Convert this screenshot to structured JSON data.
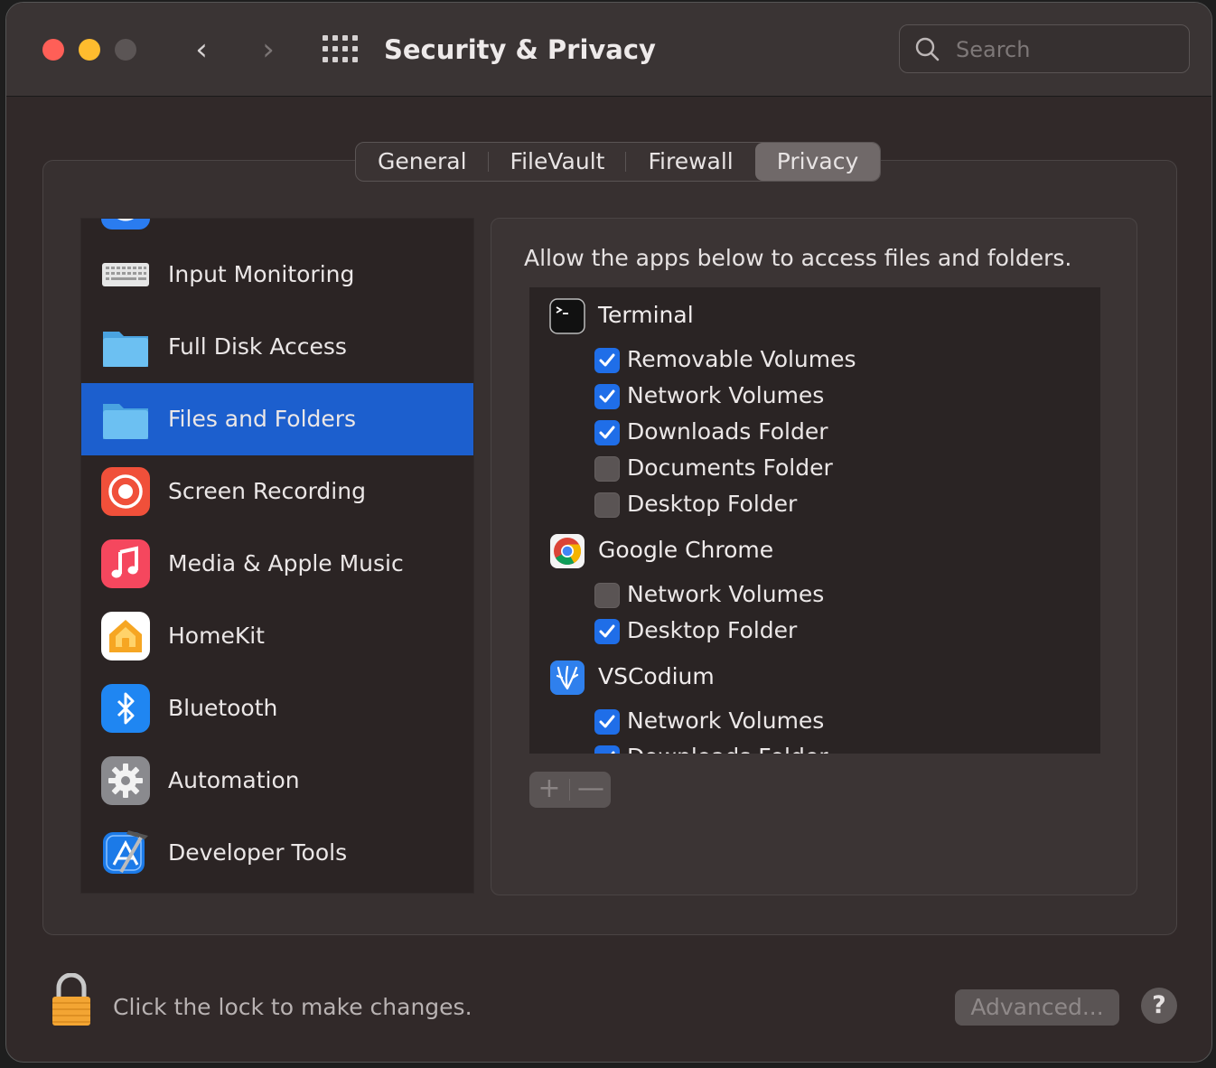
{
  "window": {
    "title": "Security & Privacy",
    "search_placeholder": "Search",
    "back_glyph": "‹",
    "forward_glyph": "›"
  },
  "tabs": [
    {
      "label": "General",
      "active": false
    },
    {
      "label": "FileVault",
      "active": false
    },
    {
      "label": "Firewall",
      "active": false
    },
    {
      "label": "Privacy",
      "active": true
    }
  ],
  "privacy_list": [
    {
      "label": "Input Monitoring",
      "icon": "keyboard-icon",
      "selected": false
    },
    {
      "label": "Full Disk Access",
      "icon": "folder-icon",
      "selected": false
    },
    {
      "label": "Files and Folders",
      "icon": "folder-icon",
      "selected": true
    },
    {
      "label": "Screen Recording",
      "icon": "screen-record-icon",
      "selected": false
    },
    {
      "label": "Media & Apple Music",
      "icon": "music-note-icon",
      "selected": false
    },
    {
      "label": "HomeKit",
      "icon": "home-icon",
      "selected": false
    },
    {
      "label": "Bluetooth",
      "icon": "bluetooth-icon",
      "selected": false
    },
    {
      "label": "Automation",
      "icon": "gear-icon",
      "selected": false
    },
    {
      "label": "Developer Tools",
      "icon": "developer-tools-icon",
      "selected": false
    }
  ],
  "detail": {
    "description": "Allow the apps below to access files and folders.",
    "apps": [
      {
        "name": "Terminal",
        "icon": "terminal-icon",
        "permissions": [
          {
            "label": "Removable Volumes",
            "checked": true
          },
          {
            "label": "Network Volumes",
            "checked": true
          },
          {
            "label": "Downloads Folder",
            "checked": true
          },
          {
            "label": "Documents Folder",
            "checked": false
          },
          {
            "label": "Desktop Folder",
            "checked": false
          }
        ]
      },
      {
        "name": "Google Chrome",
        "icon": "chrome-icon",
        "permissions": [
          {
            "label": "Network Volumes",
            "checked": false
          },
          {
            "label": "Desktop Folder",
            "checked": true
          }
        ]
      },
      {
        "name": "VSCodium",
        "icon": "vscodium-icon",
        "permissions": [
          {
            "label": "Network Volumes",
            "checked": true
          },
          {
            "label": "Downloads Folder",
            "checked": true
          }
        ]
      }
    ],
    "add_glyph": "+",
    "remove_glyph": "—"
  },
  "footer": {
    "lock_text": "Click the lock to make changes.",
    "advanced_label": "Advanced...",
    "help_label": "?"
  },
  "colors": {
    "selection": "#1c5fce",
    "checkbox_on": "#1f6ee8",
    "close": "#ff5f57",
    "minimize": "#febc2e"
  }
}
